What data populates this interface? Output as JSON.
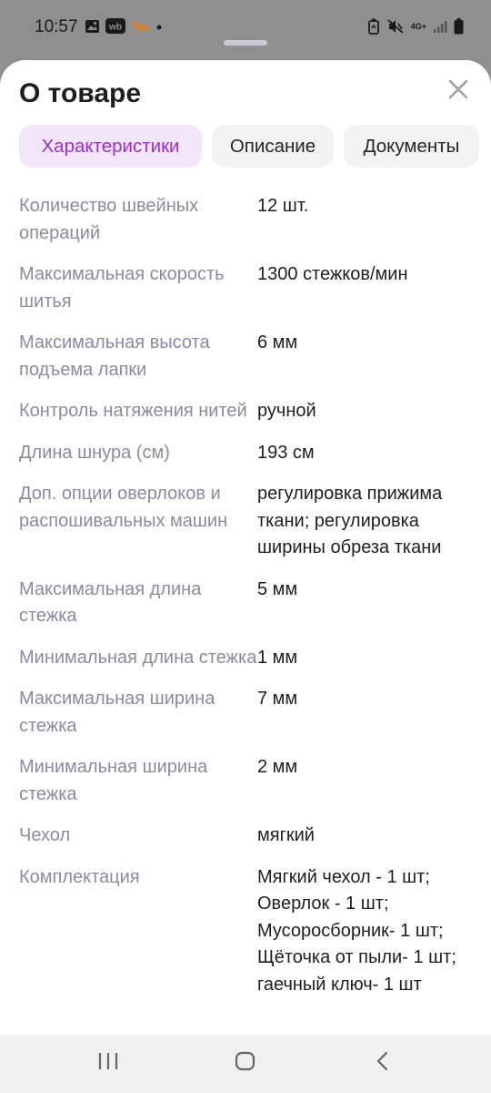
{
  "status": {
    "time": "10:57",
    "network": "4G+"
  },
  "sheet": {
    "title": "О товаре",
    "tabs": [
      {
        "label": "Характеристики",
        "active": true
      },
      {
        "label": "Описание",
        "active": false
      },
      {
        "label": "Документы",
        "active": false
      }
    ],
    "specs": [
      {
        "key": "Количество швейных операций",
        "value": "12 шт."
      },
      {
        "key": "Максимальная скорость шитья",
        "value": "1300 стежков/мин"
      },
      {
        "key": "Максимальная высота подъема лапки",
        "value": "6 мм"
      },
      {
        "key": "Контроль натяжения нитей",
        "value": "ручной"
      },
      {
        "key": "Длина шнура (см)",
        "value": "193 см"
      },
      {
        "key": "Доп. опции оверлоков и распошивальных машин",
        "value": "регулировка прижима ткани; регулировка ширины обреза ткани"
      },
      {
        "key": "Максимальная длина стежка",
        "value": "5 мм"
      },
      {
        "key": "Минимальная длина стежка",
        "value": "1 мм"
      },
      {
        "key": "Максимальная ширина стежка",
        "value": "7 мм"
      },
      {
        "key": "Минимальная ширина стежка",
        "value": "2 мм"
      },
      {
        "key": "Чехол",
        "value": "мягкий"
      },
      {
        "key": "Комплектация",
        "value": "Мягкий чехол - 1 шт; Оверлок - 1 шт; Мусоросборник- 1 шт; Щёточка от пыли- 1 шт; гаечный ключ- 1 шт"
      }
    ]
  },
  "colors": {
    "accent": "#9b2fc9",
    "accent_bg": "#f3e6fb",
    "key_text": "#8a8aa0"
  },
  "icons": [
    "gallery-icon",
    "wb-app-icon",
    "app-notification-icon",
    "dot-icon",
    "battery-saver-icon",
    "mute-vibrate-icon",
    "signal-icon",
    "battery-icon",
    "close-icon",
    "recents-icon",
    "home-icon",
    "back-icon"
  ]
}
